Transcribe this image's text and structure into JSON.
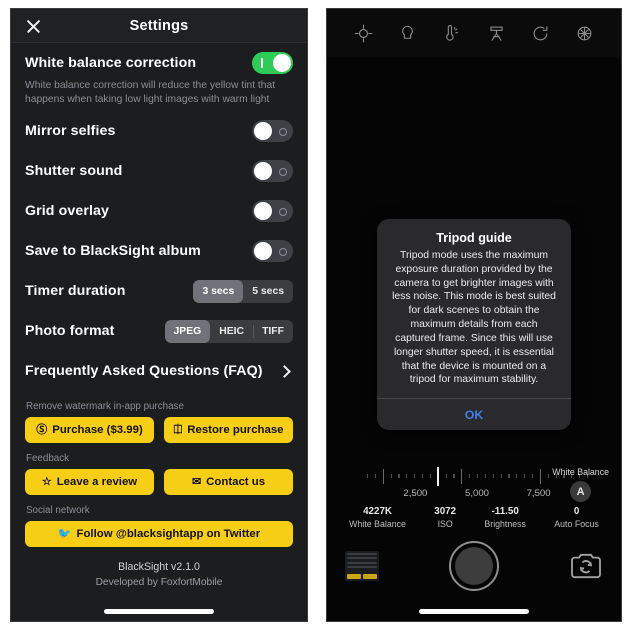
{
  "settings": {
    "header": {
      "title": "Settings",
      "close_icon": "close-icon"
    },
    "toggles": [
      {
        "label": "White balance correction",
        "state": "on",
        "description": "White balance correction will reduce the yellow tint that happens when taking low light images with warm light"
      },
      {
        "label": "Mirror selfies",
        "state": "off"
      },
      {
        "label": "Shutter sound",
        "state": "off"
      },
      {
        "label": "Grid overlay",
        "state": "off"
      },
      {
        "label": "Save to BlackSight album",
        "state": "off"
      }
    ],
    "timer": {
      "label": "Timer duration",
      "options": [
        "3 secs",
        "5 secs"
      ],
      "selected": "3 secs"
    },
    "photo_format": {
      "label": "Photo format",
      "options": [
        "JPEG",
        "HEIC",
        "TIFF"
      ],
      "selected": "JPEG"
    },
    "faq": {
      "label": "Frequently Asked Questions (FAQ)",
      "chevron_icon": "chevron-right-icon"
    },
    "purchase": {
      "caption": "Remove watermark in-app purchase",
      "buy_label": "Purchase ($3.99)",
      "buy_icon": "dollar-coin-icon",
      "restore_label": "Restore purchase",
      "restore_icon": "restore-icon"
    },
    "feedback": {
      "caption": "Feedback",
      "review_label": "Leave a review",
      "review_icon": "star-icon",
      "contact_label": "Contact us",
      "contact_icon": "envelope-icon"
    },
    "social": {
      "caption": "Social network",
      "twitter_label": "Follow @blacksightapp on Twitter",
      "twitter_icon": "twitter-bird-icon"
    },
    "footer": {
      "version": "BlackSight v2.1.0",
      "developer": "Developed by FoxfortMobile"
    },
    "colors": {
      "accent_yellow": "#f7ce16",
      "toggle_on_green": "#2ecc57"
    }
  },
  "camera": {
    "toolbar": [
      {
        "name": "focus-crosshair-icon"
      },
      {
        "name": "flashlight-icon"
      },
      {
        "name": "white-balance-icon"
      },
      {
        "name": "tripod-icon"
      },
      {
        "name": "timer-icon"
      },
      {
        "name": "settings-gear-icon"
      }
    ],
    "dialog": {
      "title": "Tripod guide",
      "message": "Tripod mode uses the maximum exposure duration provided by the camera to get brighter images with less noise. This mode is best suited for dark scenes to obtain the maximum details from each captured frame. Since this will use longer shutter speed, it is essential that the device is mounted on a tripod for maximum stability.",
      "ok_label": "OK",
      "ok_color": "#3f7fe8"
    },
    "kelvin_ruler": {
      "labels": [
        "2,500",
        "5,000",
        "7,500"
      ],
      "min": 2000,
      "max": 9000,
      "current": 4227
    },
    "readouts": [
      {
        "value": "4227K",
        "label": "White Balance"
      },
      {
        "value": "3072",
        "label": "ISO"
      },
      {
        "value": "-11.50",
        "label": "Brightness"
      },
      {
        "value": "0",
        "label": "Auto Focus"
      }
    ],
    "white_balance_badge": {
      "label": "White Balance",
      "mode": "A"
    },
    "bottom": {
      "thumbnail_icon": "gallery-thumbnail",
      "shutter_icon": "shutter-button",
      "flip_icon": "flip-camera-icon"
    }
  }
}
